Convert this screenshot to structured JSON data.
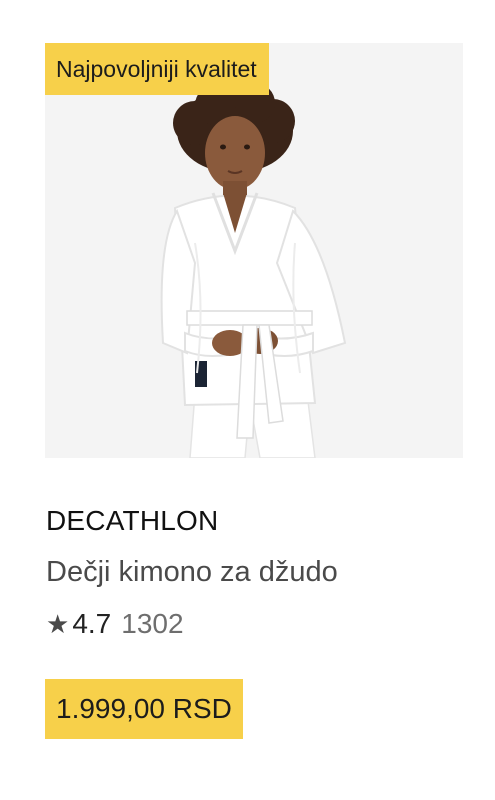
{
  "product": {
    "badge": "Najpovoljniji kvalitet",
    "brand": "DECATHLON",
    "title": "Dečji kimono za džudo",
    "rating": "4.7",
    "review_count": "1302",
    "price": "1.999,00 RSD",
    "image_subject": "child-in-white-judo-kimono",
    "star_icon": "star-icon"
  },
  "colors": {
    "highlight": "#f7d04a",
    "image_background": "#f4f4f4",
    "brand_text": "#111111",
    "title_text": "#4a4a4a",
    "review_text": "#6e6e6e"
  }
}
